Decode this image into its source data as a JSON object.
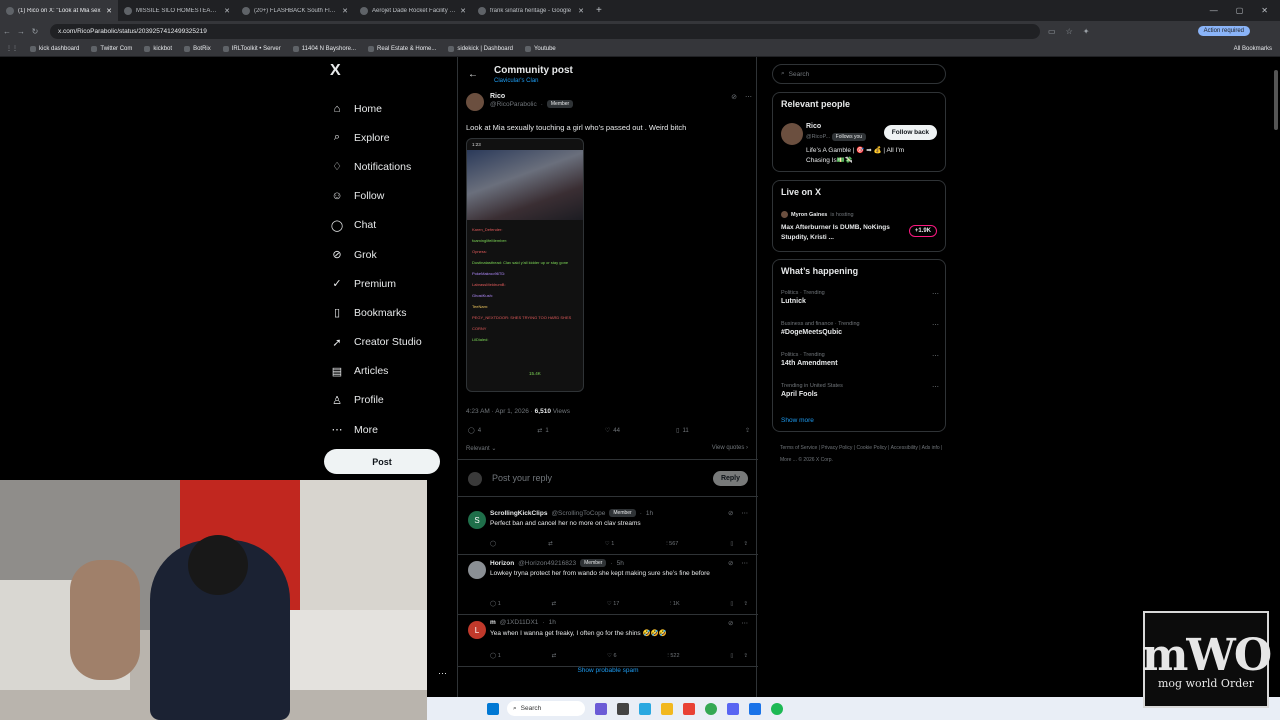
{
  "browser": {
    "tabs": [
      {
        "title": "(1) Rico on X: \"Look at Mia sex",
        "active": true
      },
      {
        "title": "MISSILE SILO HOMESTEAD - G",
        "active": false
      },
      {
        "title": "(20+) FLASHBACK South Florid",
        "active": false
      },
      {
        "title": "Aerojet Dade Rocket Facility | A",
        "active": false
      },
      {
        "title": "frank sinatra heritage - Google",
        "active": false
      }
    ],
    "url": "x.com/RicoParabolic/status/2039257412499325219",
    "action_required": "Action required",
    "bookmarks": [
      "kick dashboard",
      "Twitter Com",
      "kickbot",
      "BotRix",
      "IRLToolkit • Server",
      "11404 N Bayshore...",
      "Real Estate & Home...",
      "sidekick | Dashboard",
      "Youtube"
    ],
    "all_bookmarks": "All Bookmarks"
  },
  "nav": {
    "logo": "X",
    "items": [
      {
        "label": "Home",
        "icon": "home-icon",
        "glyph": "⌂"
      },
      {
        "label": "Explore",
        "icon": "search-icon",
        "glyph": "⌕"
      },
      {
        "label": "Notifications",
        "icon": "bell-icon",
        "glyph": "♢"
      },
      {
        "label": "Follow",
        "icon": "follow-icon",
        "glyph": "☺"
      },
      {
        "label": "Chat",
        "icon": "chat-icon",
        "glyph": "◯"
      },
      {
        "label": "Grok",
        "icon": "grok-icon",
        "glyph": "⊘"
      },
      {
        "label": "Premium",
        "icon": "premium-icon",
        "glyph": "✓"
      },
      {
        "label": "Bookmarks",
        "icon": "bookmark-icon",
        "glyph": "▯"
      },
      {
        "label": "Creator Studio",
        "icon": "rocket-icon",
        "glyph": "➚"
      },
      {
        "label": "Articles",
        "icon": "articles-icon",
        "glyph": "▤"
      },
      {
        "label": "Profile",
        "icon": "profile-icon",
        "glyph": "♙"
      },
      {
        "label": "More",
        "icon": "more-icon",
        "glyph": "⋯"
      }
    ],
    "post_button": "Post"
  },
  "main": {
    "title": "Community post",
    "community": "Clavicular's Clan",
    "post": {
      "name": "Rico",
      "handle": "@RicoParabolic",
      "badge": "Member",
      "text": "Look at Mia sexually touching a girl who’s passed out . Weird bitch",
      "media_time": "1:23",
      "chat_lines": [
        {
          "user": "Karen_Defender:",
          "cls": "c-a"
        },
        {
          "user": "foaminglifeMember:",
          "cls": "c-b"
        },
        {
          "user": "Opness:",
          "cls": "c-a"
        },
        {
          "user": "Dustinatasthead: Clav said y'all kidder up or stay gone",
          "cls": "c-b"
        },
        {
          "user": "PokeMakroo96TD:",
          "cls": "c-c"
        },
        {
          "user": "LabrassMeldrumB:",
          "cls": "c-a"
        },
        {
          "user": "GhostKush:",
          "cls": "c-c"
        },
        {
          "user": "TeeNam:",
          "cls": "c-d"
        },
        {
          "user": "PEGY_NEXTDOOR: SHES TRYING TOO HARD SHES CORNY",
          "cls": "c-a"
        },
        {
          "user": "LilDialed:",
          "cls": "c-b"
        }
      ],
      "media_count": "15.4K",
      "time": "4:23 AM · Apr 1, 2026 ·",
      "views_num": "6,510",
      "views_label": "Views",
      "replies": "4",
      "reposts": "1",
      "likes": "44",
      "bookmarks": "11"
    },
    "relevant": "Relevant",
    "view_quotes": "View quotes",
    "reply_placeholder": "Post your reply",
    "reply_button": "Reply",
    "comments": [
      {
        "name": "ScrollingKickClips",
        "handle": "@ScrollingToCope",
        "badge": "Member",
        "time": "1h",
        "text": "Perfect ban and cancel her no more on clav streams",
        "replies": "",
        "reposts": "",
        "likes": "1",
        "views": "567",
        "avatar_letter": "S",
        "avatar_color": "#1f6f4a"
      },
      {
        "name": "Horizon",
        "handle": "@Horizon49216823",
        "badge": "Member",
        "time": "5h",
        "text": "Lowkey tryna protect her from wando she kept making sure she’s fine before",
        "replies": "1",
        "reposts": "",
        "likes": "17",
        "views": "1K",
        "avatar_letter": "",
        "avatar_color": "#8a8f94"
      },
      {
        "name": "m",
        "handle": "@1XD11DX1",
        "badge": "",
        "time": "1h",
        "text": "Yea when I wanna get freaky, I often go for the shins 🤣🤣🤣",
        "replies": "1",
        "reposts": "",
        "likes": "6",
        "views": "522",
        "avatar_letter": "L",
        "avatar_color": "#c0392b"
      }
    ],
    "show_spam": "Show probable spam"
  },
  "right": {
    "search_placeholder": "Search",
    "relevant_people": {
      "title": "Relevant people",
      "name": "Rico",
      "handle": "@RicoP...",
      "follows_you": "Follows you",
      "follow_button": "Follow back",
      "bio": "Life’s A Gamble | 🎯 ➡ 💰 | All I’m Chasing Is💵💸"
    },
    "live": {
      "title": "Live on X",
      "host": "Myron Gaines",
      "host_suffix": "is hosting",
      "stream_title": "Max Afterburner Is DUMB, NoKings Stupdity, Kristi ...",
      "listeners": "+1.9K"
    },
    "happening": {
      "title": "What’s happening",
      "trends": [
        {
          "category": "Politics · Trending",
          "title": "Lutnick"
        },
        {
          "category": "Business and finance · Trending",
          "title": "#DogeMeetsQubic"
        },
        {
          "category": "Politics · Trending",
          "title": "14th Amendment"
        },
        {
          "category": "Trending in United States",
          "title": "April Fools"
        }
      ],
      "show_more": "Show more"
    },
    "footer": "Terms of Service  |  Privacy Policy  |  Cookie Policy  |  Accessibility  |  Ads info  |  More ...  © 2026 X Corp."
  },
  "taskbar": {
    "search": "Search"
  },
  "overlay": {
    "logo_big": "mWO",
    "logo_small": "mog world Order"
  }
}
